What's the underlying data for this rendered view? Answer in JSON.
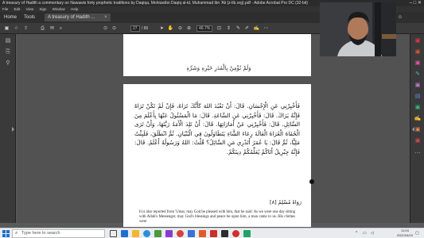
{
  "window": {
    "title": "A treasury of Hadith a commentary on Nawawis forty prophetic traditions by Daqiqa, Mohiuwibn Daqiq al-id, Muhammad ibn 'Ali (z-lib.org).pdf - Adobe Acrobat Pro DC (32-bit)",
    "controls": "–  □  ✕"
  },
  "menu": [
    "File",
    "Edit",
    "View",
    "Sign",
    "Window",
    "Help"
  ],
  "tabs": {
    "home": "Home",
    "tools": "Tools",
    "document": "A treasury of Hadith ...",
    "close": "×"
  },
  "toolbar": {
    "page_current": "27",
    "page_total": "/ 86",
    "zoom": "46.7%"
  },
  "document": {
    "page1_fragment": "وَلَمْ تُؤْمِنْ بِالْقَدَرِ خَيْرِهِ وَشَرِّهِ",
    "arabic_paragraph": "فَأَخْبِرْنِي عَنِ الْإِحْسَانِ. قَالَ: أَنْ تَعْبُدَ اللهَ كَأَنَّكَ تَرَاهُ، فَإِنْ لَمْ تَكُنْ تَرَاهُ فَإِنَّهُ يَرَاكَ. قَالَ: فَأَخْبِرْنِي عَنِ السَّاعَةِ. قَالَ: مَا الْمَسْئُولُ عَنْهَا بِأَعْلَمَ مِنَ السَّائِلِ. قَالَ: فَأَخْبِرْنِي عَنْ أَمَارَاتِهَا. قَالَ: أَنْ تَلِدَ الْأَمَةُ رَبَّتَهَا، وَأَنْ تَرَى الْحُفَاةَ الْعُرَاةَ الْعَالَةَ رِعَاءَ الشَّاءِ يَتَطَاوَلُونَ فِي الْبُنْيَانِ. ثُمَّ انْطَلَقَ، فَلَبِثْتُ مَلِيًّا، ثُمَّ قَالَ: يَا عُمَرُ أَتَدْرِي مَنِ السَّائِلُ؟ قُلْتُ: اللهُ وَرَسُولُهُ أَعْلَمُ. قَالَ: فَإِنَّهُ جِبْرِيلُ أَتَاكُمْ يُعَلِّمُكُمْ دِينَكُمْ.",
    "arabic_reference": "رَوَاهُ مُسْلِمٌ [٨]",
    "english_paragraph": "It is also reported from 'Umar, may God be pleased with him, that he said: As we were one day sitting with Allah's Messenger, may God's blessings and peace be upon him, a man came to us. His clothes were"
  },
  "taskbar": {
    "search_placeholder": "Type here to search",
    "time": "11:04",
    "date": "2021/04/10"
  },
  "colors": {
    "acrobat_red": "#c9302c",
    "taskbar_bg": "#e9ecef"
  }
}
